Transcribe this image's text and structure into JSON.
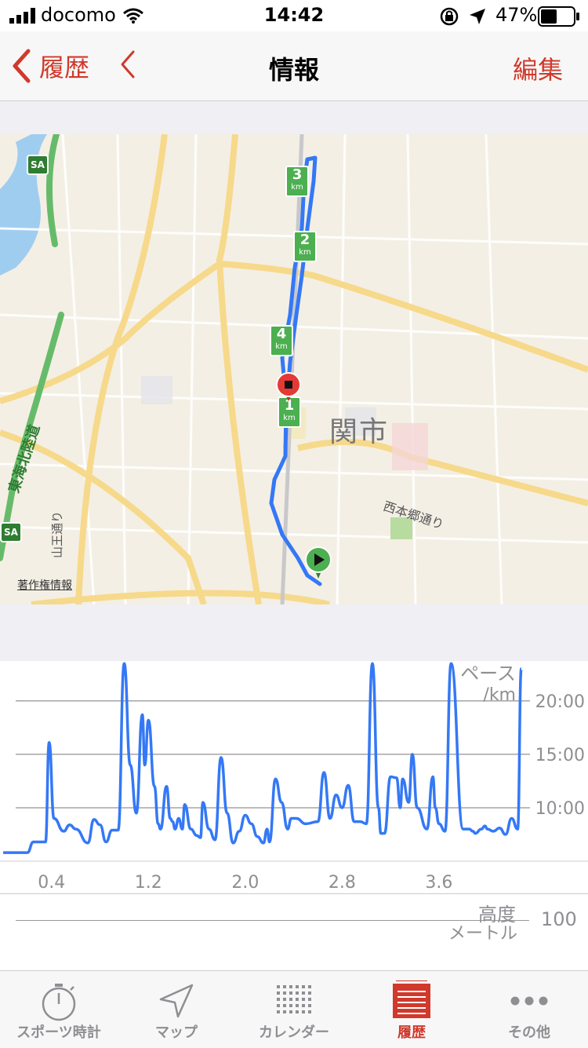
{
  "status_bar": {
    "carrier": "docomo",
    "time": "14:42",
    "battery": "47%"
  },
  "nav": {
    "back_label": "履歴",
    "title": "情報",
    "edit_label": "編集"
  },
  "map": {
    "city_label": "関市",
    "street_label_1": "西本郷通り",
    "street_label_2": "山王通り",
    "highway_label": "東海北陸道",
    "sa_label": "SA",
    "copyright_label": "著作権情報",
    "km_markers": [
      {
        "num": "1",
        "unit": "km"
      },
      {
        "num": "2",
        "unit": "km"
      },
      {
        "num": "3",
        "unit": "km"
      },
      {
        "num": "4",
        "unit": "km"
      }
    ]
  },
  "chart_data": {
    "type": "line",
    "title": "",
    "ylabel": "ペース",
    "yunit": "/km",
    "xlim": [
      0,
      4.3
    ],
    "ylim": [
      5,
      23
    ],
    "y_ticks": [
      "10:00",
      "15:00",
      "20:00"
    ],
    "y_tick_values": [
      10,
      15,
      20
    ],
    "x_ticks": [
      "0.4",
      "1.2",
      "2.0",
      "2.8",
      "3.6"
    ],
    "x_tick_values": [
      0.4,
      1.2,
      2.0,
      2.8,
      3.6
    ],
    "series": [
      {
        "color": "#3478f6",
        "x": [
          0,
          0.2,
          0.25,
          0.35,
          0.38,
          0.42,
          0.5,
          0.55,
          0.6,
          0.7,
          0.75,
          0.8,
          0.85,
          0.9,
          0.95,
          1.0,
          1.05,
          1.1,
          1.15,
          1.17,
          1.2,
          1.25,
          1.28,
          1.3,
          1.35,
          1.38,
          1.4,
          1.42,
          1.45,
          1.48,
          1.5,
          1.55,
          1.6,
          1.63,
          1.65,
          1.7,
          1.75,
          1.8,
          1.85,
          1.9,
          1.95,
          2.0,
          2.05,
          2.1,
          2.15,
          2.18,
          2.2,
          2.25,
          2.3,
          2.35,
          2.38,
          2.42,
          2.5,
          2.6,
          2.65,
          2.7,
          2.75,
          2.8,
          2.85,
          2.9,
          2.95,
          3.0,
          3.05,
          3.1,
          3.12,
          3.15,
          3.2,
          3.25,
          3.28,
          3.3,
          3.35,
          3.38,
          3.42,
          3.5,
          3.55,
          3.57,
          3.6,
          3.65,
          3.7,
          3.8,
          3.82,
          3.85,
          3.88,
          3.9,
          3.95,
          3.98,
          4.0,
          4.05,
          4.1,
          4.15,
          4.2,
          4.25,
          4.28
        ],
        "y": [
          5.8,
          5.8,
          6.8,
          6.8,
          16.1,
          9.0,
          7.8,
          8.4,
          8.0,
          6.7,
          8.9,
          8.4,
          6.8,
          7.9,
          7.9,
          23.5,
          14.0,
          9.5,
          18.7,
          14.0,
          18.2,
          12.0,
          8.5,
          8.0,
          12.0,
          9.0,
          8.7,
          8.0,
          9.0,
          8.0,
          10.3,
          8.0,
          7.4,
          7.2,
          10.5,
          8.0,
          7.0,
          14.7,
          9.5,
          6.7,
          7.8,
          9.3,
          8.5,
          7.3,
          6.7,
          8.0,
          6.8,
          12.7,
          10.5,
          8.0,
          9.0,
          9.0,
          8.5,
          8.7,
          13.3,
          9.0,
          11.2,
          10.0,
          12.1,
          8.7,
          8.7,
          8.5,
          23.5,
          10.0,
          7.6,
          7.6,
          12.9,
          12.8,
          10.0,
          12.7,
          10.5,
          15.0,
          10.0,
          8.0,
          12.9,
          10.0,
          8.5,
          7.8,
          23.5,
          8.0,
          8.0,
          8.0,
          7.8,
          7.6,
          8.0,
          8.3,
          8.0,
          7.8,
          8.1,
          7.5,
          9.0,
          8.0,
          23.0
        ]
      }
    ]
  },
  "elevation": {
    "label": "高度",
    "unit": "メートル",
    "tick": "100"
  },
  "tabs": [
    {
      "label": "スポーツ時計",
      "icon": "stopwatch-icon"
    },
    {
      "label": "マップ",
      "icon": "location-arrow-icon"
    },
    {
      "label": "カレンダー",
      "icon": "calendar-grid-icon"
    },
    {
      "label": "履歴",
      "icon": "history-list-icon"
    },
    {
      "label": "その他",
      "icon": "more-dots-icon"
    }
  ],
  "colors": {
    "accent": "#d0392b",
    "route": "#3478f6",
    "marker_green": "#4caf50"
  }
}
